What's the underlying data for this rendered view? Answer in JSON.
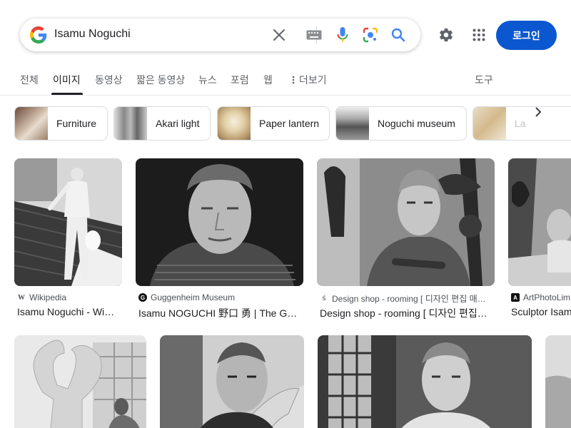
{
  "search": {
    "query": "Isamu Noguchi"
  },
  "header": {
    "login_label": "로그인"
  },
  "tabs": [
    {
      "label": "전체"
    },
    {
      "label": "이미지"
    },
    {
      "label": "동영상"
    },
    {
      "label": "짧은 동영상"
    },
    {
      "label": "뉴스"
    },
    {
      "label": "포럼"
    },
    {
      "label": "웹"
    },
    {
      "label": "더보기"
    },
    {
      "label": "도구"
    }
  ],
  "chips": [
    {
      "label": "Furniture"
    },
    {
      "label": "Akari light"
    },
    {
      "label": "Paper lantern"
    },
    {
      "label": "Noguchi museum"
    },
    {
      "label": "La"
    }
  ],
  "results": [
    {
      "source": "Wikipedia",
      "title": "Isamu Noguchi - Wi…",
      "favicon": "W"
    },
    {
      "source": "Guggenheim Museum",
      "title": "Isamu NOGUCHI 野口 勇 | The G…",
      "favicon": "G"
    },
    {
      "source": "Design shop - rooming [ 디자인 편집 매…",
      "title": "Design shop - rooming [ 디자인 편집…",
      "favicon": "ś"
    },
    {
      "source": "ArtPhotoLim",
      "title": "Sculptor Isam",
      "favicon": "A"
    }
  ],
  "colors": {
    "accent": "#0b57d0",
    "google_blue": "#4285F4",
    "google_red": "#EA4335",
    "google_yellow": "#FBBC05",
    "google_green": "#34A853"
  },
  "icons": [
    "google-logo-icon",
    "clear-icon",
    "keyboard-icon",
    "mic-icon",
    "lens-icon",
    "search-icon",
    "settings-icon",
    "apps-icon",
    "more-vert-icon",
    "chevron-right-icon"
  ]
}
